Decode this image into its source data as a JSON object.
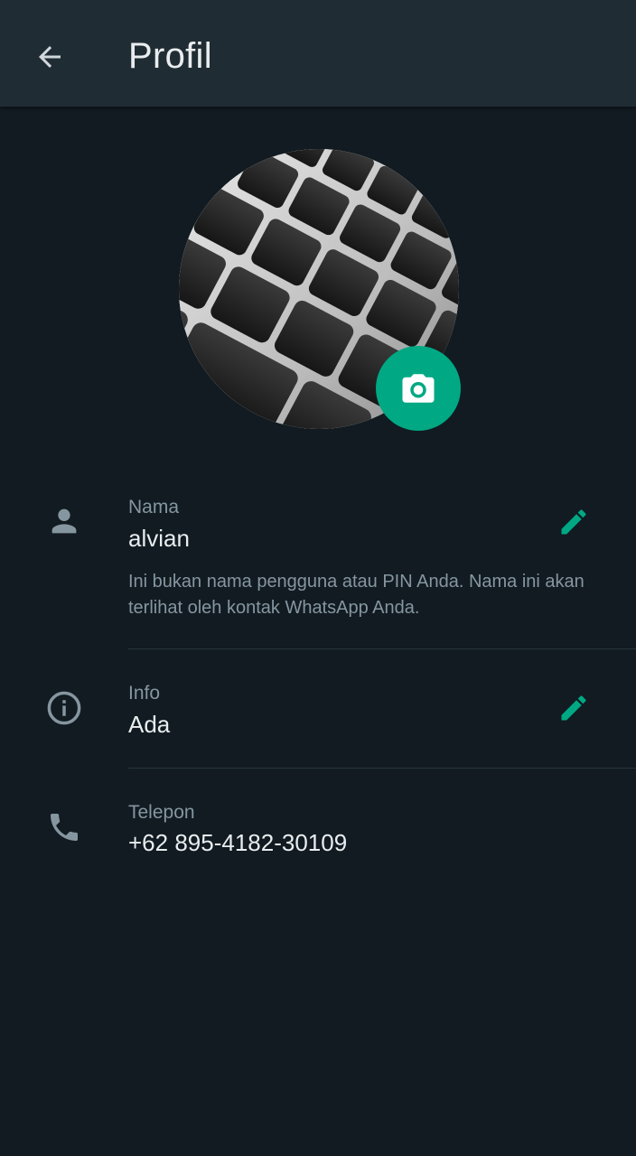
{
  "header": {
    "title": "Profil",
    "back_icon": "arrow-back-icon"
  },
  "avatar": {
    "camera_icon": "camera-icon"
  },
  "name_section": {
    "icon": "person-icon",
    "label": "Nama",
    "value": "alvian",
    "hint": "Ini bukan nama pengguna atau PIN Anda. Nama ini akan terlihat oleh kontak WhatsApp Anda.",
    "edit_icon": "pencil-icon"
  },
  "info_section": {
    "icon": "info-icon",
    "label": "Info",
    "value": "Ada",
    "edit_icon": "pencil-icon"
  },
  "phone_section": {
    "icon": "phone-icon",
    "label": "Telepon",
    "value": "+62 895-4182-30109"
  },
  "colors": {
    "background": "#111b21",
    "app_bar": "#202c33",
    "accent": "#00a884",
    "primary_text": "#e9edef",
    "secondary_text": "#8696a0"
  }
}
